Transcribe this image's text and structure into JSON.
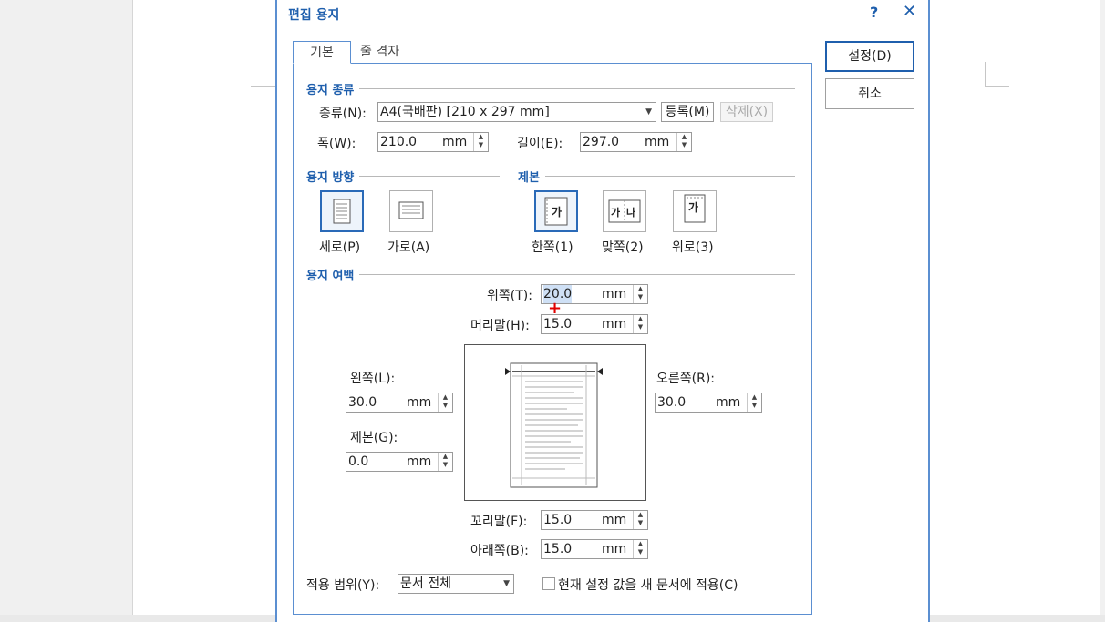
{
  "dialog": {
    "title": "편집 용지",
    "help": "?",
    "close": "✕",
    "ok_label": "설정(D)",
    "cancel_label": "취소"
  },
  "tabs": {
    "basic": "기본",
    "grid": "줄 격자"
  },
  "paper_type": {
    "section": "용지 종류",
    "kind_label": "종류(N):",
    "kind_value": "A4(국배판)  [210 x 297 mm]",
    "register": "등록(M)",
    "delete": "삭제(X)",
    "width_label": "폭(W):",
    "width_value": "210.0",
    "height_label": "길이(E):",
    "height_value": "297.0",
    "unit": "mm"
  },
  "orientation": {
    "section": "용지 방향",
    "portrait": "세로(P)",
    "landscape": "가로(A)",
    "selected": "portrait"
  },
  "binding": {
    "section": "제본",
    "single": "한쪽(1)",
    "facing": "맞쪽(2)",
    "top": "위로(3)",
    "icon_text_single": "가",
    "icon_text_facing_1": "가",
    "icon_text_facing_2": "나",
    "icon_text_top": "가",
    "selected": "single"
  },
  "margins": {
    "section": "용지 여백",
    "top_label": "위쪽(T):",
    "top_value": "20.0",
    "header_label": "머리말(H):",
    "header_value": "15.0",
    "left_label": "왼쪽(L):",
    "left_value": "30.0",
    "right_label": "오른쪽(R):",
    "right_value": "30.0",
    "gutter_label": "제본(G):",
    "gutter_value": "0.0",
    "footer_label": "꼬리말(F):",
    "footer_value": "15.0",
    "bottom_label": "아래쪽(B):",
    "bottom_value": "15.0",
    "unit": "mm"
  },
  "apply": {
    "scope_label": "적용 범위(Y):",
    "scope_value": "문서 전체",
    "new_doc_label": "현재 설정 값을 새 문서에 적용(C)",
    "new_doc_checked": false
  },
  "colors": {
    "accent": "#1f5fad",
    "border": "#5b8fd1"
  }
}
